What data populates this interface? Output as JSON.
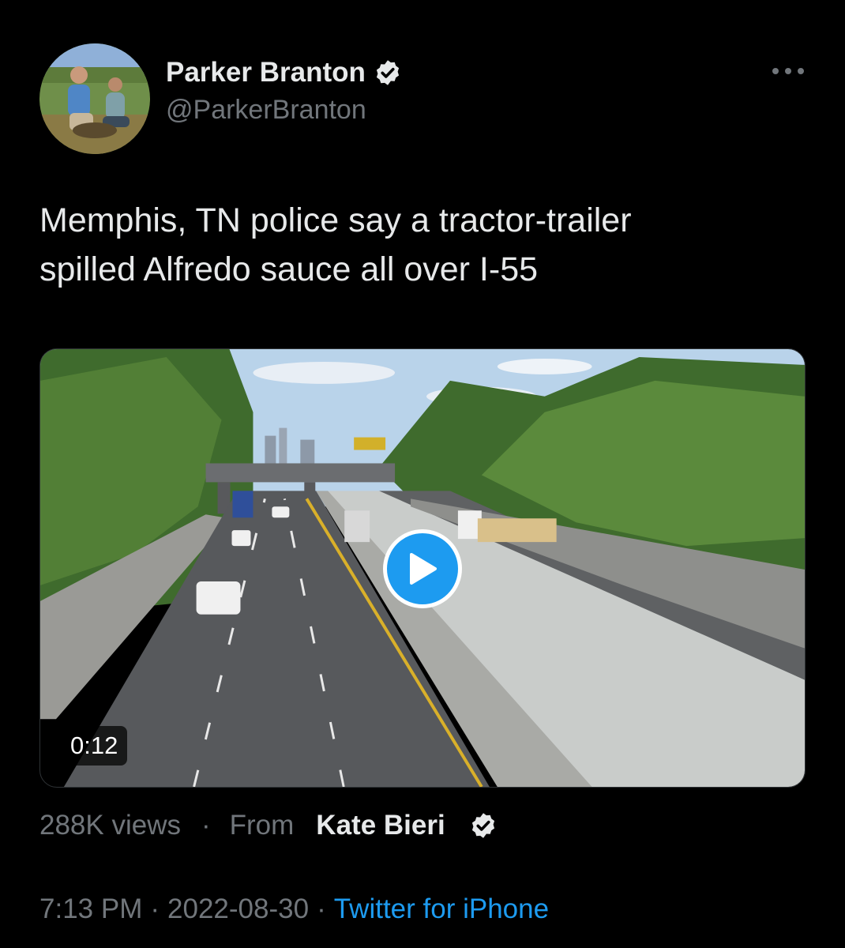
{
  "author": {
    "display_name": "Parker Branton",
    "handle": "@ParkerBranton",
    "verified_icon": "verified-badge-icon",
    "avatar": "profile-photo"
  },
  "more_icon": "more-options-icon",
  "tweet": {
    "text": "Memphis, TN police say a tractor-trailer\nspilled Alfredo sauce all over I-55"
  },
  "video": {
    "duration": "0:12",
    "play_icon": "play-icon"
  },
  "stats": {
    "views": "288K views",
    "separator": "·",
    "from_label": "From",
    "source_name": "Kate Bieri",
    "source_verified_icon": "verified-badge-icon"
  },
  "meta": {
    "time": "7:13 PM",
    "separator_1": "·",
    "date": "2022-08-30",
    "separator_2": "·",
    "client": "Twitter for iPhone"
  },
  "colors": {
    "background": "#000000",
    "text_primary": "#e7e9ea",
    "text_secondary": "#71767b",
    "accent": "#1d9bf0"
  }
}
